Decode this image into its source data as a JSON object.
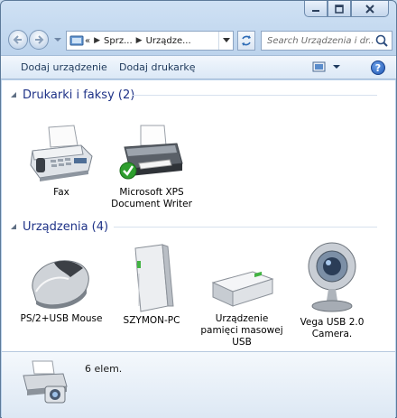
{
  "navigation": {
    "breadcrumbs": [
      "«",
      "Sprz...",
      "Urządze..."
    ],
    "search_placeholder": "Search Urządzenia i dr..."
  },
  "commands": {
    "add_device": "Dodaj urządzenie",
    "add_printer": "Dodaj drukarkę",
    "help": "?"
  },
  "groups": [
    {
      "title": "Drukarki i faksy (2)",
      "items": [
        {
          "label": "Fax",
          "icon": "fax-icon"
        },
        {
          "label": "Microsoft XPS Document Writer",
          "icon": "printer-default-icon"
        }
      ]
    },
    {
      "title": "Urządzenia (4)",
      "items": [
        {
          "label": "PS/2+USB Mouse",
          "icon": "mouse-icon"
        },
        {
          "label": "SZYMON-PC",
          "icon": "computer-icon"
        },
        {
          "label": "Urządzenie pamięci masowej USB",
          "icon": "usb-storage-icon"
        },
        {
          "label": "Vega USB 2.0 Camera.",
          "icon": "webcam-icon"
        }
      ]
    }
  ],
  "details": {
    "count": "6 elem.",
    "icon": "devices-printers-icon"
  },
  "colors": {
    "group_header": "#1e3287",
    "command_text": "#1e395b",
    "default_check": "#2e9e2e"
  }
}
